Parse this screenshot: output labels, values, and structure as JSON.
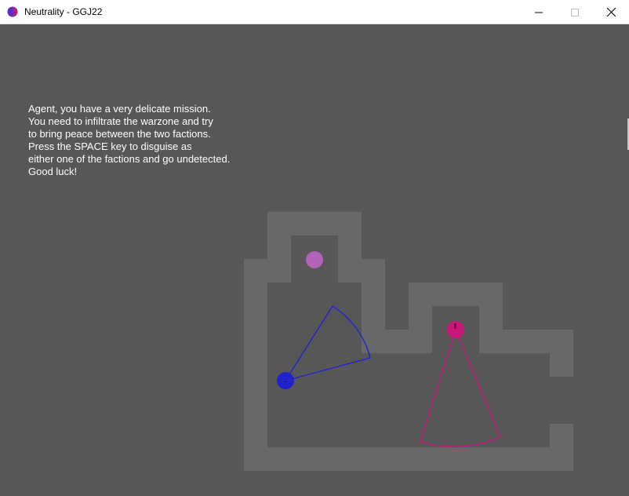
{
  "window": {
    "title": "Neutrality - GGJ22",
    "controls": {
      "minimize": "minimize-icon",
      "maximize": "maximize-icon",
      "close": "close-icon"
    }
  },
  "game": {
    "background_color": "#575757",
    "wall_color": "#686868",
    "intro_lines": [
      "Agent, you have a very delicate mission.",
      "You need to infiltrate the warzone and try",
      "to bring peace between the two factions.",
      "Press the SPACE key to disguise as",
      "either one of the factions and go undetected.",
      "Good luck!"
    ],
    "entities": {
      "player": {
        "color": "#b163b6"
      },
      "blue_guard": {
        "color": "#2222cc"
      },
      "pink_guard": {
        "color": "#c8157a"
      }
    }
  }
}
